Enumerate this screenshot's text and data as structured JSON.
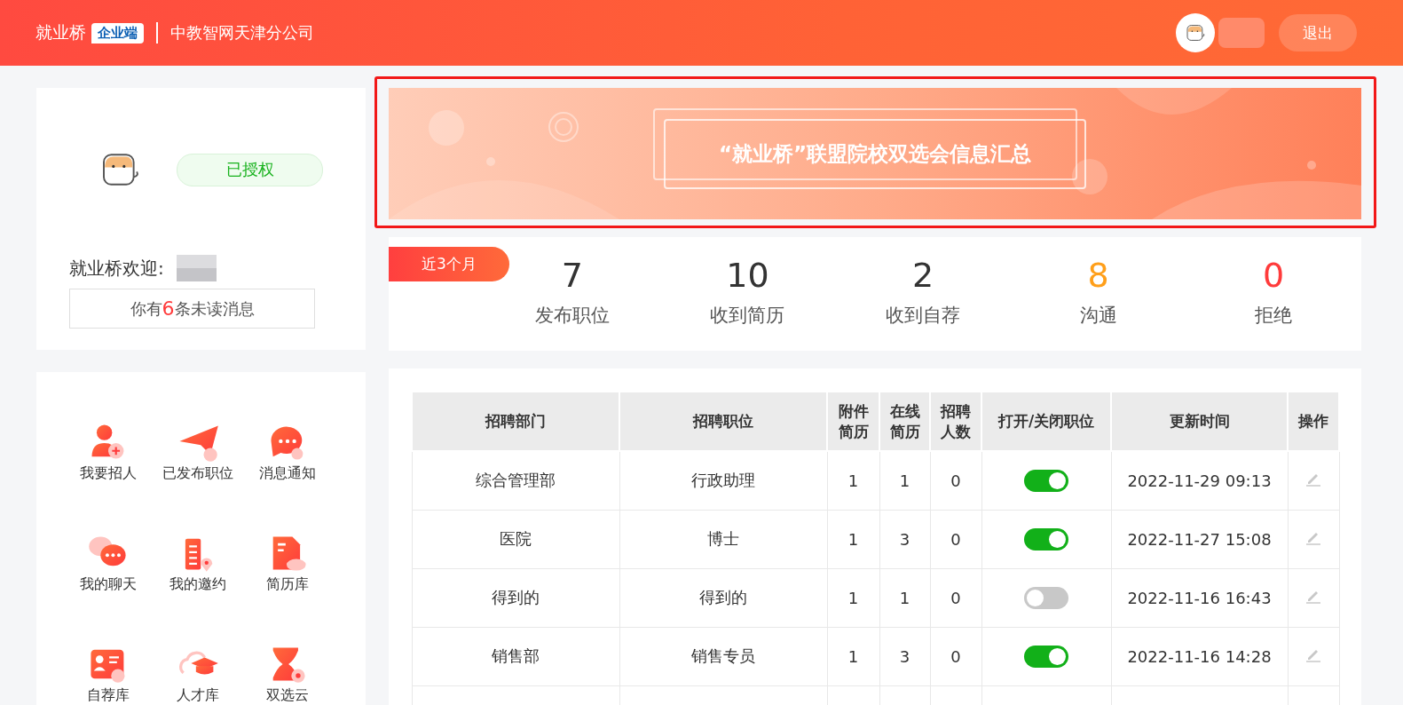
{
  "header": {
    "brand": "就业桥",
    "badge": "企业端",
    "company": "中教智网天津分公司",
    "logout": "退出"
  },
  "profile": {
    "status": "已授权",
    "welcome": "就业桥欢迎:",
    "unread": {
      "prefix": "你有",
      "count": "6",
      "suffix": "条未读消息"
    }
  },
  "shortcuts": [
    {
      "label": "我要招人"
    },
    {
      "label": "已发布职位"
    },
    {
      "label": "消息通知"
    },
    {
      "label": "我的聊天"
    },
    {
      "label": "我的邀约"
    },
    {
      "label": "简历库"
    },
    {
      "label": "自荐库"
    },
    {
      "label": "人才库"
    },
    {
      "label": "双选云"
    }
  ],
  "banner": {
    "title": "“就业桥”联盟院校双选会信息汇总"
  },
  "stats": {
    "period": "近3个月",
    "items": [
      {
        "value": "7",
        "label": "发布职位",
        "color": "#333333"
      },
      {
        "value": "10",
        "label": "收到简历",
        "color": "#333333"
      },
      {
        "value": "2",
        "label": "收到自荐",
        "color": "#333333"
      },
      {
        "value": "8",
        "label": "沟通",
        "color": "#ff9f1a"
      },
      {
        "value": "0",
        "label": "拒绝",
        "color": "#ff3b3b"
      }
    ]
  },
  "table": {
    "columns": [
      "招聘部门",
      "招聘职位",
      "附件简历",
      "在线简历",
      "招聘人数",
      "打开/关闭职位",
      "更新时间",
      "操作"
    ],
    "rows": [
      {
        "department": "综合管理部",
        "position": "行政助理",
        "attachment": "1",
        "online": "1",
        "headcount": "0",
        "on": true,
        "updated": "2022-11-29 09:13"
      },
      {
        "department": "医院",
        "position": "博士",
        "attachment": "1",
        "online": "3",
        "headcount": "0",
        "on": true,
        "updated": "2022-11-27 15:08"
      },
      {
        "department": "得到的",
        "position": "得到的",
        "attachment": "1",
        "online": "1",
        "headcount": "0",
        "on": false,
        "updated": "2022-11-16 16:43"
      },
      {
        "department": "销售部",
        "position": "销售专员",
        "attachment": "1",
        "online": "3",
        "headcount": "0",
        "on": true,
        "updated": "2022-11-16 14:28"
      }
    ]
  }
}
